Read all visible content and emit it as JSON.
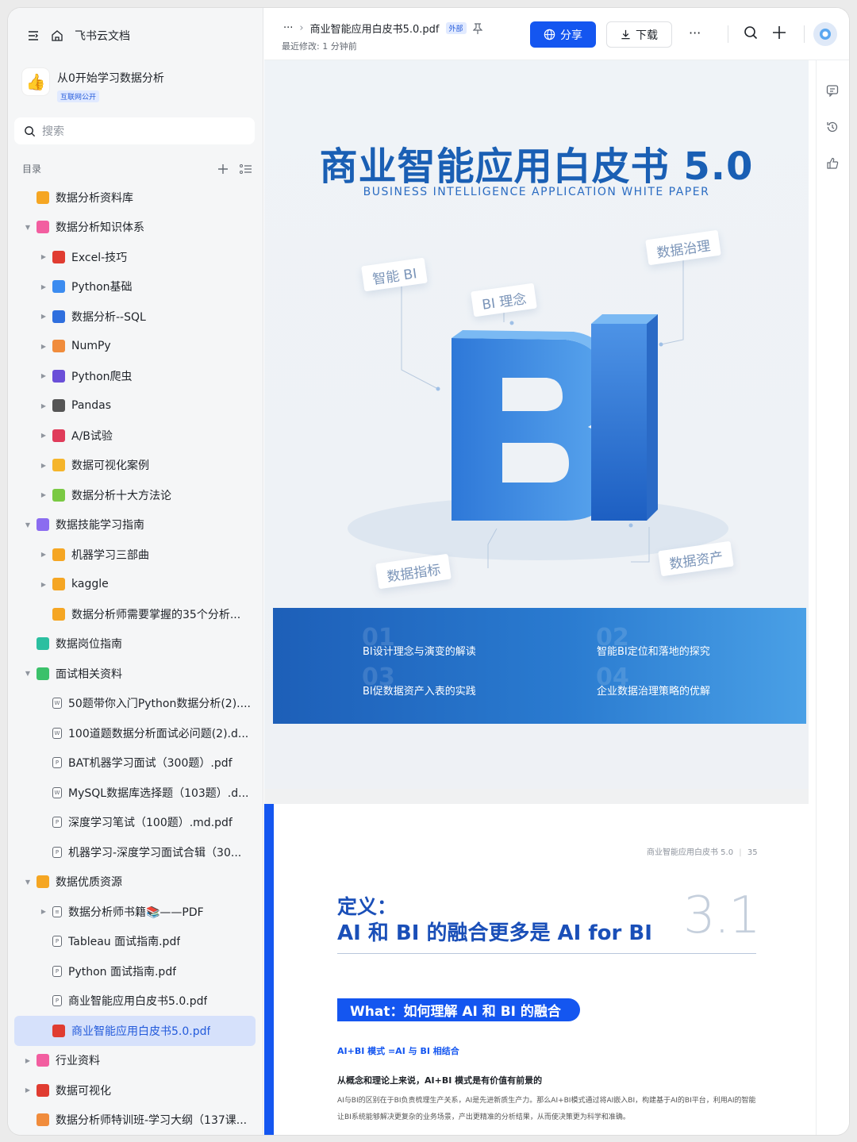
{
  "app": {
    "name": "飞书云文档"
  },
  "workspace": {
    "name": "从0开始学习数据分析",
    "badge": "互联网公开"
  },
  "search": {
    "placeholder": "搜索"
  },
  "toc": {
    "label": "目录"
  },
  "tree": [
    {
      "label": "数据分析资料库",
      "level": 0,
      "arrow": "",
      "icon_color": "#f5a623"
    },
    {
      "label": "数据分析知识体系",
      "level": 0,
      "arrow": "▼",
      "icon_color": "#f25ea0"
    },
    {
      "label": "Excel-技巧",
      "level": 1,
      "arrow": "▶",
      "icon_color": "#e03c31"
    },
    {
      "label": "Python基础",
      "level": 1,
      "arrow": "▶",
      "icon_color": "#3c8cf0"
    },
    {
      "label": "数据分析--SQL",
      "level": 1,
      "arrow": "▶",
      "icon_color": "#2f6fde"
    },
    {
      "label": "NumPy",
      "level": 1,
      "arrow": "▶",
      "icon_color": "#f08c3c"
    },
    {
      "label": "Python爬虫",
      "level": 1,
      "arrow": "▶",
      "icon_color": "#6a4fd8"
    },
    {
      "label": "Pandas",
      "level": 1,
      "arrow": "▶",
      "icon_color": "#555555"
    },
    {
      "label": "A/B试验",
      "level": 1,
      "arrow": "▶",
      "icon_color": "#e03c5a"
    },
    {
      "label": "数据可视化案例",
      "level": 1,
      "arrow": "▶",
      "icon_color": "#f5b52b"
    },
    {
      "label": "数据分析十大方法论",
      "level": 1,
      "arrow": "▶",
      "icon_color": "#7ac943"
    },
    {
      "label": "数据技能学习指南",
      "level": 0,
      "arrow": "▼",
      "icon_color": "#8b6cf0"
    },
    {
      "label": "机器学习三部曲",
      "level": 1,
      "arrow": "▶",
      "icon_color": "#f5a623"
    },
    {
      "label": "kaggle",
      "level": 1,
      "arrow": "▶",
      "icon_color": "#f5a623"
    },
    {
      "label": "数据分析师需要掌握的35个分析...",
      "level": 1,
      "arrow": "",
      "icon_color": "#f5a623"
    },
    {
      "label": "数据岗位指南",
      "level": 0,
      "arrow": "",
      "icon_color": "#2bbfa0"
    },
    {
      "label": "面试相关资料",
      "level": 0,
      "arrow": "▼",
      "icon_color": "#3bc16a"
    },
    {
      "label": "50题带你入门Python数据分析(2)....",
      "level": 1,
      "arrow": "",
      "doc": "W"
    },
    {
      "label": "100道题数据分析面试必问题(2).d...",
      "level": 1,
      "arrow": "",
      "doc": "W"
    },
    {
      "label": "BAT机器学习面试（300题）.pdf",
      "level": 1,
      "arrow": "",
      "doc": "P"
    },
    {
      "label": "MySQL数据库选择题（103题）.d...",
      "level": 1,
      "arrow": "",
      "doc": "W"
    },
    {
      "label": "深度学习笔试（100题）.md.pdf",
      "level": 1,
      "arrow": "",
      "doc": "P"
    },
    {
      "label": "机器学习-深度学习面试合辑（30...",
      "level": 1,
      "arrow": "",
      "doc": "P"
    },
    {
      "label": "数据优质资源",
      "level": 0,
      "arrow": "▼",
      "icon_color": "#f5a623"
    },
    {
      "label": "数据分析师书籍📚——PDF",
      "level": 1,
      "arrow": "▶",
      "doc": "≡"
    },
    {
      "label": "Tableau 面试指南.pdf",
      "level": 1,
      "arrow": "",
      "doc": "P"
    },
    {
      "label": "Python 面试指南.pdf",
      "level": 1,
      "arrow": "",
      "doc": "P"
    },
    {
      "label": "商业智能应用白皮书5.0.pdf",
      "level": 1,
      "arrow": "",
      "doc": "P"
    },
    {
      "label": "商业智能应用白皮书5.0.pdf",
      "level": 1,
      "arrow": "",
      "icon_color": "#e03c31",
      "selected": true
    },
    {
      "label": "行业资料",
      "level": 0,
      "arrow": "▶",
      "icon_color": "#f25ea0"
    },
    {
      "label": "数据可视化",
      "level": 0,
      "arrow": "▶",
      "icon_color": "#e03c31"
    },
    {
      "label": "数据分析师特训班-学习大纲（137课...",
      "level": 0,
      "arrow": "",
      "icon_color": "#f08c3c"
    }
  ],
  "header": {
    "ellipsis": "···",
    "file_name": "商业智能应用白皮书5.0.pdf",
    "external_tag": "外部",
    "modified": "最近修改: 1 分钟前",
    "share_label": "分享",
    "download_label": "下载"
  },
  "page1": {
    "title": "商业智能应用白皮书 5.0",
    "subtitle": "BUSINESS INTELLIGENCE APPLICATION WHITE PAPER",
    "tags": [
      "智能 BI",
      "BI 理念",
      "数据治理",
      "数据指标",
      "数据资产"
    ],
    "graphic_text": "BI",
    "band": [
      {
        "num": "01",
        "text": "BI设计理念与演变的解读"
      },
      {
        "num": "02",
        "text": "智能BI定位和落地的探究"
      },
      {
        "num": "03",
        "text": "BI促数据资产入表的实践"
      },
      {
        "num": "04",
        "text": "企业数据治理策略的优解"
      }
    ]
  },
  "page2": {
    "running_head": "商业智能应用白皮书 5.0",
    "page_number": "35",
    "definition": "定义：",
    "heading": "AI 和 BI 的融合更多是 AI for BI",
    "section_number": "3.1",
    "pill": "What：如何理解 AI 和 BI 的融合",
    "subheading": "AI+BI 模式 =AI 与 BI 相结合",
    "lead": "从概念和理论上来说，AI+BI 模式是有价值有前景的",
    "body": "AI与BI的区别在于BI负责梳理生产关系，AI是先进新质生产力。那么AI+BI模式通过将AI嵌入BI，构建基于AI的BI平台，利用AI的智能让BI系统能够解决更复杂的业务场景，产出更精准的分析结果，从而使决策更为科学和准确。"
  },
  "colors": {
    "accent": "#1456f0",
    "selected_bg": "#d6e1fb"
  }
}
